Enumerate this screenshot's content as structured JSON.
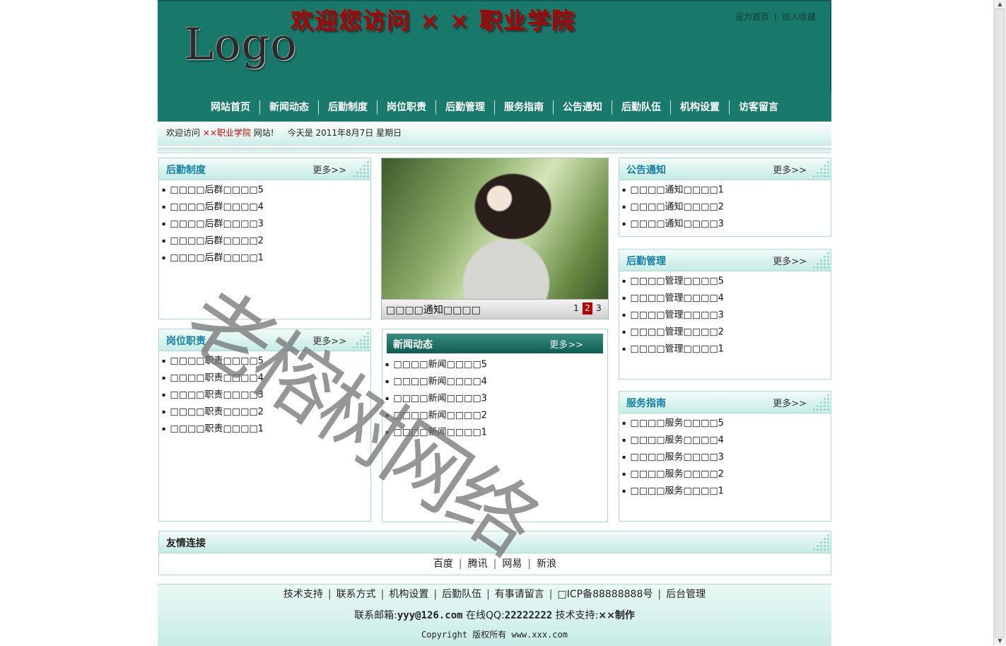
{
  "header": {
    "logo_text": "Logo",
    "welcome_title": "欢迎您访问 × × 职业学院",
    "set_home": "设为首页",
    "add_favorite": "加入收藏",
    "bg_color": "#18786a"
  },
  "nav": {
    "items": [
      "网站首页",
      "新闻动态",
      "后勤制度",
      "岗位职责",
      "后勤管理",
      "服务指南",
      "公告通知",
      "后勤队伍",
      "机构设置",
      "访客留言"
    ]
  },
  "infobar": {
    "prefix": "欢迎访问",
    "school": "××职业学院",
    "suffix": "网站!",
    "today": "今天是 2011年8月7日 星期日"
  },
  "boxes": {
    "logistics_rules": {
      "title": "后勤制度",
      "more": "更多>>",
      "items": [
        "□□□□后群□□□□5",
        "□□□□后群□□□□4",
        "□□□□后群□□□□3",
        "□□□□后群□□□□2",
        "□□□□后群□□□□1"
      ]
    },
    "job_duties": {
      "title": "岗位职责",
      "more": "更多>>",
      "items": [
        "□□□□职责□□□□5",
        "□□□□职责□□□□4",
        "□□□□职责□□□□3",
        "□□□□职责□□□□2",
        "□□□□职责□□□□1"
      ]
    },
    "news": {
      "title": "新闻动态",
      "more": "更多>>",
      "items": [
        "□□□□新闻□□□□5",
        "□□□□新闻□□□□4",
        "□□□□新闻□□□□3",
        "□□□□新闻□□□□2",
        "□□□□新闻□□□□1"
      ]
    },
    "notices": {
      "title": "公告通知",
      "more": "更多>>",
      "items": [
        "□□□□通知□□□□1",
        "□□□□通知□□□□2",
        "□□□□通知□□□□3"
      ]
    },
    "logistics_mgmt": {
      "title": "后勤管理",
      "more": "更多>>",
      "items": [
        "□□□□管理□□□□5",
        "□□□□管理□□□□4",
        "□□□□管理□□□□3",
        "□□□□管理□□□□2",
        "□□□□管理□□□□1"
      ]
    },
    "service_guide": {
      "title": "服务指南",
      "more": "更多>>",
      "items": [
        "□□□□服务□□□□5",
        "□□□□服务□□□□4",
        "□□□□服务□□□□3",
        "□□□□服务□□□□2",
        "□□□□服务□□□□1"
      ]
    }
  },
  "slideshow": {
    "caption": "□□□□通知□□□□",
    "pages": [
      "1",
      "2",
      "3"
    ],
    "active_page": "2"
  },
  "friend_links": {
    "title": "友情连接",
    "items": [
      "百度",
      "腾讯",
      "网易",
      "新浪"
    ]
  },
  "footer": {
    "links": [
      "技术支持",
      "联系方式",
      "机构设置",
      "后勤队伍",
      "有事请留言",
      "□ICP备88888888号",
      "后台管理"
    ],
    "email_label": "联系邮箱:",
    "email": "yyy@126.com",
    "qq_label": "在线QQ:",
    "qq": "22222222",
    "support_label": "技术支持:",
    "support": "××制作",
    "copyright": "Copyright 版权所有 www.xxx.com"
  },
  "watermark": "老榕树网络"
}
